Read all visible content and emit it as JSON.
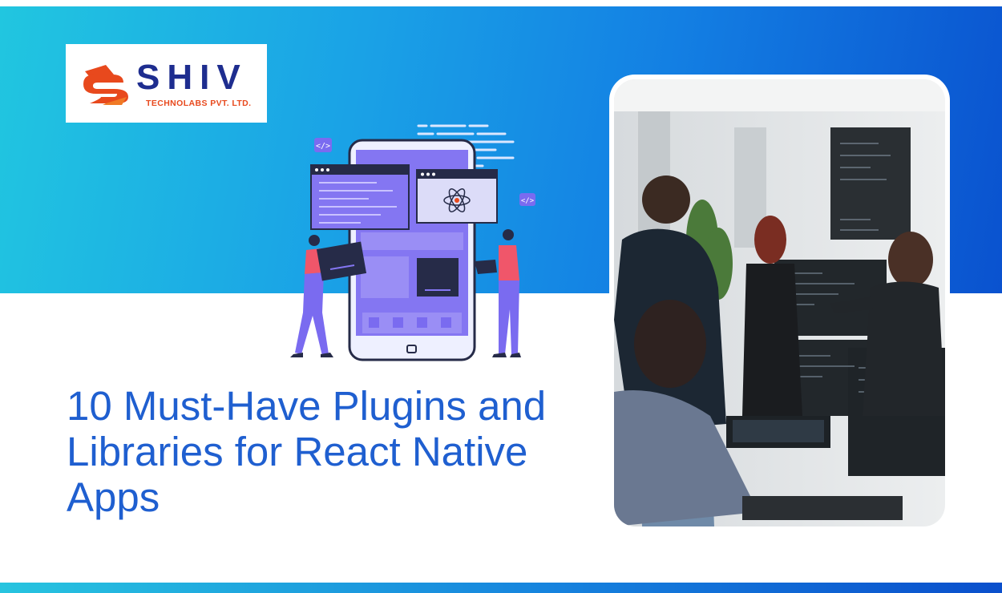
{
  "brand": {
    "name": "SHIV",
    "tagline": "TECHNOLABS PVT. LTD.",
    "colors": {
      "navy": "#1e2d8f",
      "orange": "#e8491d"
    }
  },
  "article": {
    "title": "10 Must-Have Plugins and Libraries for React Native Apps"
  },
  "illustration": {
    "code_tags": [
      "</>",
      "</>"
    ]
  },
  "colors": {
    "banner_start": "#21c6e0",
    "banner_end": "#0a52cf",
    "headline": "#1f5fd0",
    "illustration_purple": "#7a6bf0",
    "illustration_navy": "#262b48"
  }
}
